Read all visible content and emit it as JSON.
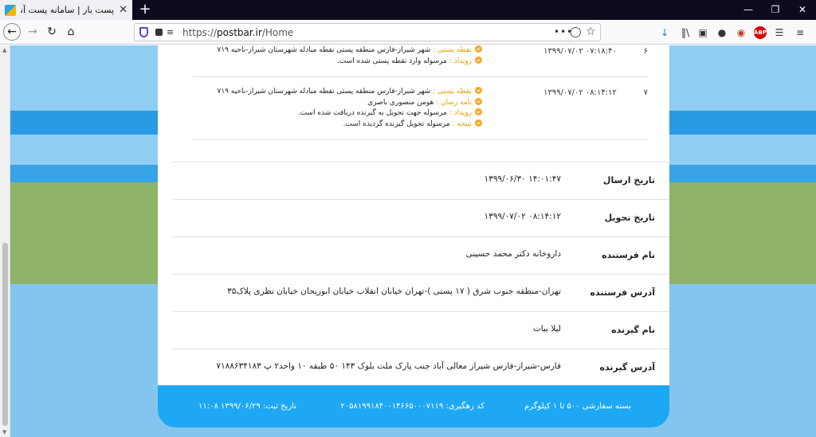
{
  "browser": {
    "tab_title": "پست بار | سامانه پست آنلاین کشور",
    "tab_close": "✕",
    "new_tab": "+",
    "url_prefix": "https://",
    "url_host": "postbar.ir",
    "url_path": "/Home",
    "window_minimize": "—",
    "window_restore": "❐",
    "window_close": "✕"
  },
  "events": [
    {
      "num": "۶",
      "date": "۱۳۹۹/۰۷/۰۲ ۰۷:۱۸:۴۰",
      "lines": [
        {
          "label": "نقطه پستی :",
          "text": " شهر شیراز-فارس منطقه پستی نقطه مبادله شهرستان شیراز-ناحیه ۷۱۹"
        },
        {
          "label": "رویداد :",
          "text": " مرسوله وارد نقطه پستی شده است."
        }
      ]
    },
    {
      "num": "۷",
      "date": "۱۳۹۹/۰۷/۰۲ ۰۸:۱۴:۱۲",
      "lines": [
        {
          "label": "نقطه پستی :",
          "text": " شهر شیراز-فارس منطقه پستی نقطه مبادله شهرستان شیراز-ناحیه ۷۱۹"
        },
        {
          "label": "نامه رسان :",
          "text": " هومن منصوری باصری"
        },
        {
          "label": "رویداد :",
          "text": " مرسوله جهت تحویل به گیرنده دریافت شده است."
        },
        {
          "label": "نتیجه :",
          "text": " مرسوله تحویل گیرنده گردیده است."
        }
      ]
    }
  ],
  "details": [
    {
      "label": "تاریخ ارسال",
      "value": "۱۳۹۹/۰۶/۳۰ ۱۴:۰۱:۴۷"
    },
    {
      "label": "تاریخ تحویل",
      "value": "۱۳۹۹/۰۷/۰۲ ۰۸:۱۴:۱۲"
    },
    {
      "label": "نام فرستنده",
      "value": "داروخانه دکتر محمد حسینی"
    },
    {
      "label": "آدرس فرستنده",
      "value": "تهران-منطقه جنوب شرق ( ۱۷ پستی )-تهران خیابان انقلاب خیابان ابوریحان خیابان نظری پلاک۳۵"
    },
    {
      "label": "نام گیرنده",
      "value": "لیلا بیات"
    },
    {
      "label": "آدرس گیرنده",
      "value": "فارس-شیراز-فارس شیراز معالی آباد جنب پارک ملت بلوک ۱۴۳ ۵۰ طبقه ۱۰ واحد۲ پ ۷۱۸۸۶۳۴۱۸۳"
    }
  ],
  "footer": {
    "package": "بسته سفارشی ۵۰۰ تا ۱ کیلوگرم",
    "tracking": "کد رهگیری: ۲۰۵۸۱۹۹۱۸۴۰۰۱۴۶۶۵۰۰۰۷۱۱۹",
    "registered": "تاریخ ثبت: ۱۳۹۹/۰۶/۲۹ ۱۱:۰۸"
  }
}
